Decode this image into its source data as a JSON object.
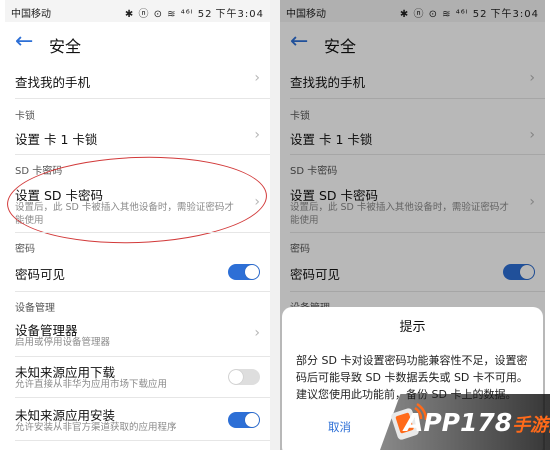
{
  "status": {
    "carrier": "中国移动",
    "icons": "✱ ⓝ ⊙ ≋ ⁴⁶ᴵ 52",
    "time": "下午3:04"
  },
  "header": {
    "title": "安全"
  },
  "left": {
    "find_phone": "查找我的手机",
    "sim_lock_section": "卡锁",
    "sim_lock": "设置 卡 1 卡锁",
    "sd_section": "SD 卡密码",
    "sd_password": "设置 SD 卡密码",
    "sd_password_desc": "设置后，此 SD 卡被插入其他设备时，需验证密码才能使用",
    "password_section": "密码",
    "password_visible": "密码可见",
    "device_mgmt_section": "设备管理",
    "device_manager": "设备管理器",
    "device_manager_desc": "启用或停用设备管理器",
    "unknown_download": "未知来源应用下载",
    "unknown_download_desc": "允许直接从非华为应用市场下载应用",
    "unknown_install": "未知来源应用安装",
    "unknown_install_desc": "允许安装从非官方渠道获取的应用程序"
  },
  "right": {
    "find_phone": "查找我的手机",
    "sim_lock_section": "卡锁",
    "sim_lock": "设置 卡 1 卡锁",
    "sd_section": "SD 卡密码",
    "sd_password": "设置 SD 卡密码",
    "sd_password_desc": "设置后，此 SD 卡被插入其他设备时，需验证密码才能使用",
    "password_section": "密码",
    "password_visible": "密码可见",
    "device_mgmt_section": "设备管理"
  },
  "dialog": {
    "title": "提示",
    "body": "部分 SD 卡对设置密码功能兼容性不足，设置密码后可能导致 SD 卡数据丢失或 SD 卡不可用。建议您使用此功能前，备份 SD 卡上的数据。",
    "cancel": "取消"
  },
  "toggles": {
    "password_visible": true,
    "unknown_download": false,
    "unknown_install": true
  },
  "watermark": {
    "text": "APP178",
    "accent": "手游网"
  },
  "colors": {
    "accent": "#2d6fd6",
    "annotation": "#d23a3a"
  }
}
